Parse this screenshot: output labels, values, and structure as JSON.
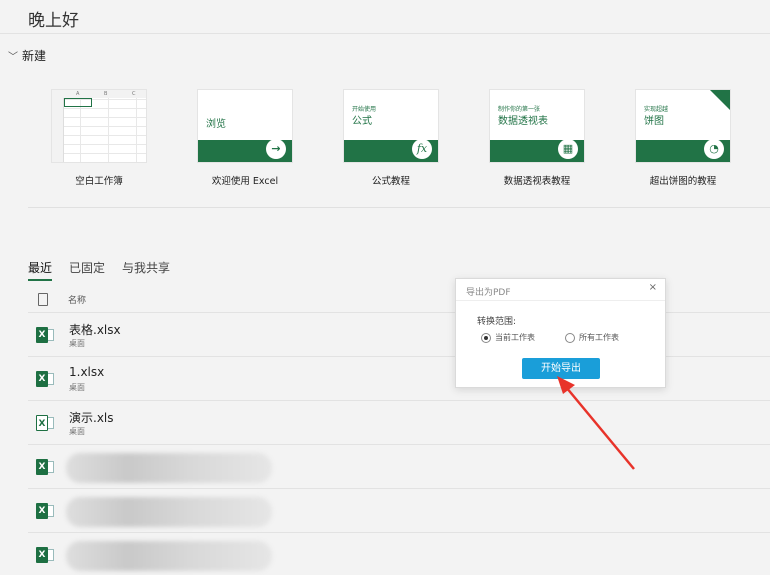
{
  "greeting": "晚上好",
  "new_section": {
    "chevron": "chevron-down-icon",
    "label": "新建"
  },
  "templates": [
    {
      "caption": "空白工作簿",
      "kind": "blank",
      "grid_cols": [
        "A",
        "B",
        "C"
      ],
      "grid_rows": [
        "1",
        "2",
        "3",
        "4",
        "5",
        "6",
        "7"
      ]
    },
    {
      "caption": "欢迎使用 Excel",
      "kind": "green",
      "small": "",
      "big": "浏览",
      "badge": "→"
    },
    {
      "caption": "公式教程",
      "kind": "green",
      "small": "开始使用",
      "big": "公式",
      "badge": "fx"
    },
    {
      "caption": "数据透视表教程",
      "kind": "green",
      "small": "制作你的第一张",
      "big": "数据透视表",
      "badge": "▦"
    },
    {
      "caption": "超出饼图的教程",
      "kind": "green",
      "small": "实现超越",
      "big": "饼图",
      "badge": "◔"
    }
  ],
  "tabs": [
    {
      "label": "最近",
      "active": true
    },
    {
      "label": "已固定",
      "active": false
    },
    {
      "label": "与我共享",
      "active": false
    }
  ],
  "column_header": "名称",
  "files": [
    {
      "name": "表格.xlsx",
      "location": "桌面",
      "icon": "excel-icon"
    },
    {
      "name": "1.xlsx",
      "location": "桌面",
      "icon": "excel-icon"
    },
    {
      "name": "演示.xls",
      "location": "桌面",
      "icon": "excel-legacy-icon"
    },
    {
      "name": "",
      "location": "",
      "icon": "excel-icon",
      "blurred": true
    },
    {
      "name": "",
      "location": "",
      "icon": "excel-icon",
      "blurred": true
    },
    {
      "name": "",
      "location": "",
      "icon": "excel-icon",
      "blurred": true
    }
  ],
  "dialog": {
    "title": "导出为PDF",
    "close": "×",
    "range_label": "转换范围:",
    "options": [
      {
        "label": "当前工作表",
        "selected": true
      },
      {
        "label": "所有工作表",
        "selected": false
      }
    ],
    "start_button": "开始导出"
  },
  "colors": {
    "excel_green": "#217346",
    "button_blue": "#1a9ed9",
    "arrow_red": "#e8332a"
  }
}
